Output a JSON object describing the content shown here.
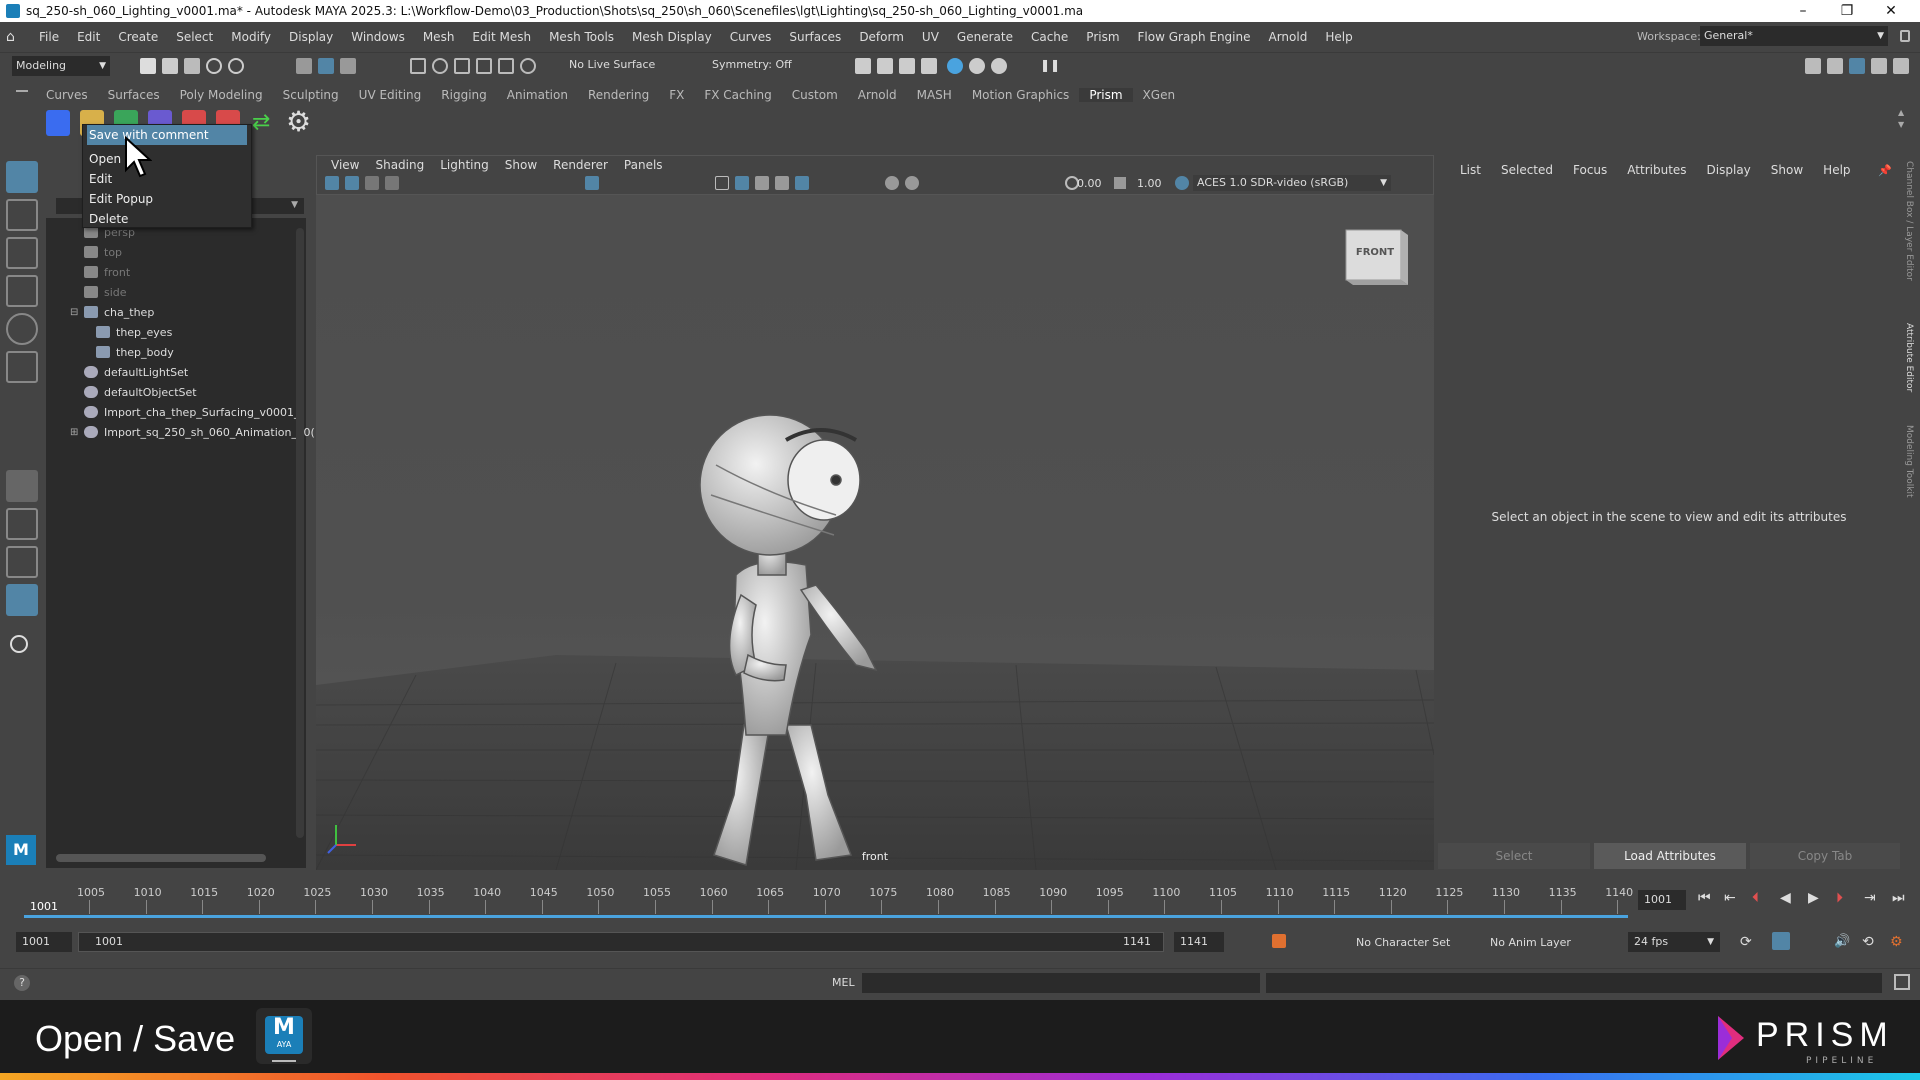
{
  "window": {
    "title": "sq_250-sh_060_Lighting_v0001.ma* - Autodesk MAYA 2025.3: L:\\Workflow-Demo\\03_Production\\Shots\\sq_250\\sh_060\\Scenefiles\\lgt\\Lighting\\sq_250-sh_060_Lighting_v0001.ma"
  },
  "menubar": {
    "items": [
      "File",
      "Edit",
      "Create",
      "Select",
      "Modify",
      "Display",
      "Windows",
      "Mesh",
      "Edit Mesh",
      "Mesh Tools",
      "Mesh Display",
      "Curves",
      "Surfaces",
      "Deform",
      "UV",
      "Generate",
      "Cache",
      "Prism",
      "Flow Graph Engine",
      "Arnold",
      "Help"
    ],
    "workspace_label": "Workspace:",
    "workspace_value": "General*"
  },
  "statusline": {
    "mode": "Modeling",
    "live_surface": "No Live Surface",
    "symmetry": "Symmetry: Off"
  },
  "shelf_tabs": [
    "Curves",
    "Surfaces",
    "Poly Modeling",
    "Sculpting",
    "UV Editing",
    "Rigging",
    "Animation",
    "Rendering",
    "FX",
    "FX Caching",
    "Custom",
    "Arnold",
    "MASH",
    "Motion Graphics",
    "Prism",
    "XGen"
  ],
  "active_shelf": "Prism",
  "context_menu": {
    "items": [
      "Save with comment",
      "Open",
      "Edit",
      "Edit Popup",
      "Delete"
    ]
  },
  "outliner": {
    "items": [
      {
        "label": "persp",
        "dim": true
      },
      {
        "label": "top",
        "dim": true
      },
      {
        "label": "front",
        "dim": true
      },
      {
        "label": "side",
        "dim": true
      },
      {
        "label": "cha_thep",
        "dim": false
      },
      {
        "label": "thep_eyes",
        "dim": false
      },
      {
        "label": "thep_body",
        "dim": false
      },
      {
        "label": "defaultLightSet",
        "dim": false
      },
      {
        "label": "defaultObjectSet",
        "dim": false
      },
      {
        "label": "Import_cha_thep_Surfacing_v0001_",
        "dim": false
      },
      {
        "label": "Import_sq_250_sh_060_Animation_v0(",
        "dim": false
      }
    ]
  },
  "viewport": {
    "menu": [
      "View",
      "Shading",
      "Lighting",
      "Show",
      "Renderer",
      "Panels"
    ],
    "exposure": "0.00",
    "gamma": "1.00",
    "color_space": "ACES 1.0 SDR-video (sRGB)",
    "camera_label": "front",
    "viewcube_label": "FRONT"
  },
  "attribute_editor": {
    "menu": [
      "List",
      "Selected",
      "Focus",
      "Attributes",
      "Display",
      "Show",
      "Help"
    ],
    "message": "Select an object in the scene to view and edit its attributes",
    "buttons": [
      "Select",
      "Load Attributes",
      "Copy Tab"
    ],
    "side_tabs": [
      "Channel Box / Layer Editor",
      "Attribute Editor",
      "Modeling Toolkit"
    ]
  },
  "timeline": {
    "ticks": [
      "1005",
      "1010",
      "1015",
      "1020",
      "1025",
      "1030",
      "1035",
      "1040",
      "1045",
      "1050",
      "1055",
      "1060",
      "1065",
      "1070",
      "1075",
      "1080",
      "1085",
      "1090",
      "1095",
      "1100",
      "1105",
      "1110",
      "1115",
      "1120",
      "1125",
      "1130",
      "1135",
      "1140"
    ],
    "current_frame_left": "1001",
    "current_frame": "1001"
  },
  "range": {
    "start": "1001",
    "slider_start": "1001",
    "slider_end": "1141",
    "end": "1141",
    "character_set": "No Character Set",
    "anim_layer": "No Anim Layer",
    "fps": "24 fps"
  },
  "cmdline": {
    "lang": "MEL"
  },
  "caption": {
    "text": "Open / Save",
    "app_badge": "M",
    "app_badge_sub": "AYA",
    "logo": "PRISM",
    "logo_sub": "PIPELINE"
  },
  "colors": {
    "highlight": "#5285a6",
    "timeline_blue": "#4aa3df",
    "prism_accent": "#e02d7e"
  }
}
